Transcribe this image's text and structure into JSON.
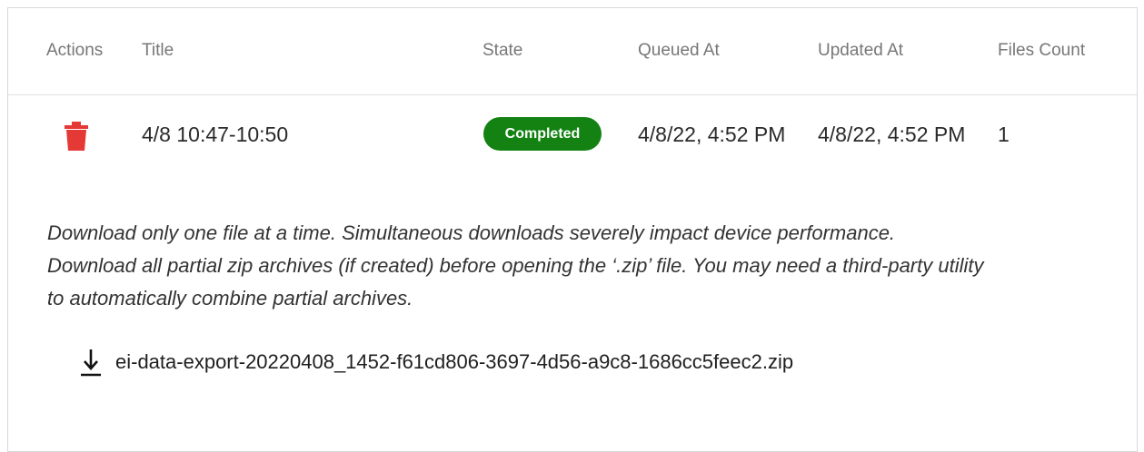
{
  "table": {
    "headers": {
      "actions": "Actions",
      "title": "Title",
      "state": "State",
      "queued_at": "Queued At",
      "updated_at": "Updated At",
      "files_count": "Files Count"
    },
    "rows": [
      {
        "action_icon": "trash-icon",
        "title": "4/8 10:47-10:50",
        "state": "Completed",
        "queued_at": "4/8/22, 4:52 PM",
        "updated_at": "4/8/22, 4:52 PM",
        "files_count": "1"
      }
    ]
  },
  "notice": {
    "line1": "Download only one file at a time. Simultaneous downloads severely impact device performance.",
    "line2": "Download all partial zip archives (if created) before opening the ‘.zip’ file. You may need a third-party utility",
    "line3": "to automatically combine partial archives."
  },
  "download": {
    "icon": "download-icon",
    "file_name": "ei-data-export-20220408_1452-f61cd806-3697-4d56-a9c8-1686cc5feec2.zip"
  },
  "colors": {
    "delete_icon": "#e53935",
    "state_badge": "#138213",
    "header_text": "#777777"
  }
}
